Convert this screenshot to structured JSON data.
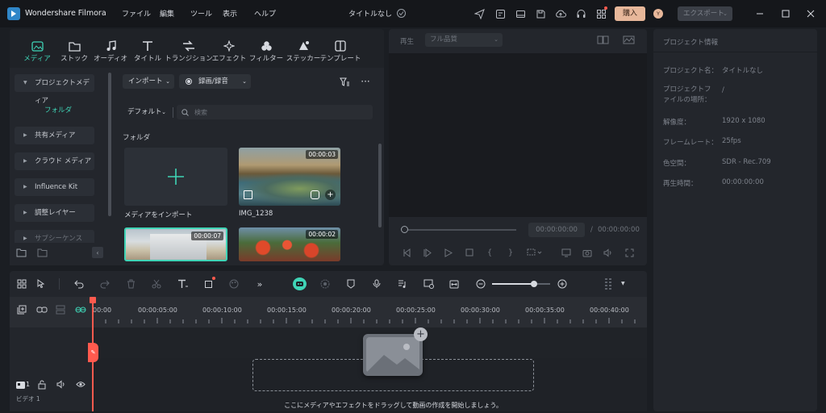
{
  "app": {
    "name": "Wondershare Filmora",
    "title": "タイトルなし"
  },
  "menu": [
    "ファイル",
    "編集",
    "ツール",
    "表示",
    "ヘルプ"
  ],
  "topbar": {
    "buy_label": "購入",
    "avatar_letter": "Y",
    "export_label": "エクスポート"
  },
  "tabs": [
    "メディア",
    "ストック",
    "オーディオ",
    "タイトル",
    "トランジション",
    "エフェクト",
    "フィルター",
    "ステッカー",
    "テンプレート"
  ],
  "sidebar": {
    "project_media": "プロジェクトメディア",
    "folder": "フォルダ",
    "items": [
      "共有メディア",
      "クラウド メディア",
      "Influence Kit",
      "調整レイヤー",
      "サブシーケンス"
    ]
  },
  "media_toolbar": {
    "import_label": "インポート",
    "record_label": "録画/録音",
    "sort_label": "デフォルト",
    "search_placeholder": "検索"
  },
  "media": {
    "section_label": "フォルダ",
    "import_tile_label": "メディアをインポート",
    "clips": [
      {
        "name": "IMG_1238",
        "duration": "00:00:03"
      },
      {
        "name": "",
        "duration": "00:00:07"
      },
      {
        "name": "",
        "duration": "00:00:02"
      }
    ]
  },
  "preview": {
    "play_label": "再生",
    "quality": "フル品質",
    "current_time": "00:00:00:00",
    "separator": "/",
    "total_time": "00:00:00:00"
  },
  "project_info": {
    "header": "プロジェクト情報",
    "rows": [
      {
        "label": "プロジェクト名：",
        "value": "タイトルなし"
      },
      {
        "label": "プロジェクトファイルの場所：",
        "value": "/"
      },
      {
        "label": "解像度：",
        "value": "1920 x 1080"
      },
      {
        "label": "フレームレート：",
        "value": "25fps"
      },
      {
        "label": "色空間：",
        "value": "SDR - Rec.709"
      },
      {
        "label": "再生時間：",
        "value": "00:00:00:00"
      }
    ]
  },
  "timeline": {
    "ticks": [
      "00:00",
      "00:00:05:00",
      "00:00:10:00",
      "00:00:15:00",
      "00:00:20:00",
      "00:00:25:00",
      "00:00:30:00",
      "00:00:35:00",
      "00:00:40:00"
    ],
    "track_number": "1",
    "track_label": "ビデオ 1",
    "drop_hint": "ここにメディアやエフェクトをドラッグして動画の作成を開始しましょう。",
    "zoom_level": 0.72
  },
  "colors": {
    "accent": "#3fd4b6",
    "buy": "#e7b79a",
    "playhead": "#ff5a4e"
  }
}
